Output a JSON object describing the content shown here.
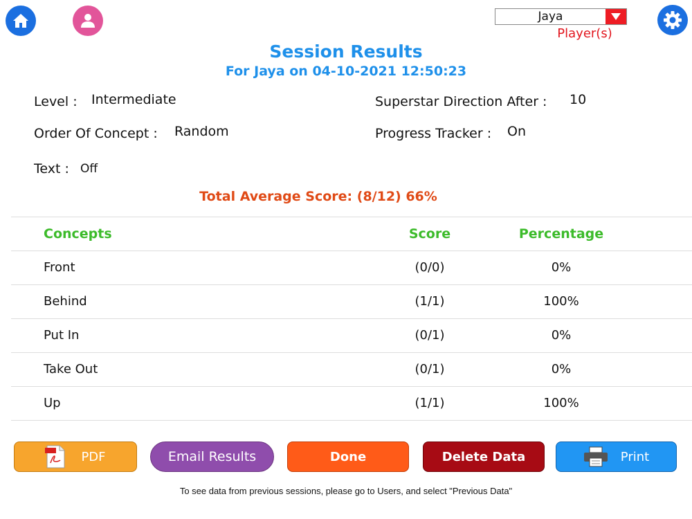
{
  "header": {
    "player_select_value": "Jaya",
    "players_label": "Player(s)"
  },
  "title": "Session Results",
  "subtitle": "For Jaya on 04-10-2021 12:50:23",
  "settings": {
    "level_label": "Level :",
    "level_value": "Intermediate",
    "superstar_label": "Superstar Direction After :",
    "superstar_value": "10",
    "order_label": "Order Of Concept :",
    "order_value": "Random",
    "progress_label": "Progress Tracker :",
    "progress_value": "On",
    "text_label": "Text :",
    "text_value": "Off"
  },
  "total_average": "Total Average Score: (8/12) 66%",
  "table": {
    "headers": [
      "Concepts",
      "Score",
      "Percentage"
    ],
    "rows": [
      [
        "Front",
        "(0/0)",
        "0%"
      ],
      [
        "Behind",
        "(1/1)",
        "100%"
      ],
      [
        "Put In",
        "(0/1)",
        "0%"
      ],
      [
        "Take Out",
        "(0/1)",
        "0%"
      ],
      [
        "Up",
        "(1/1)",
        "100%"
      ]
    ]
  },
  "buttons": {
    "pdf": "PDF",
    "email": "Email Results",
    "done": "Done",
    "delete": "Delete Data",
    "print": "Print"
  },
  "footer_note": "To see data from previous sessions, please go to Users, and select \"Previous Data\"",
  "colors": {
    "title_blue": "#1e90ea",
    "header_green": "#3cbb2a",
    "total_orange": "#e04a16",
    "players_red": "#e2141c"
  }
}
